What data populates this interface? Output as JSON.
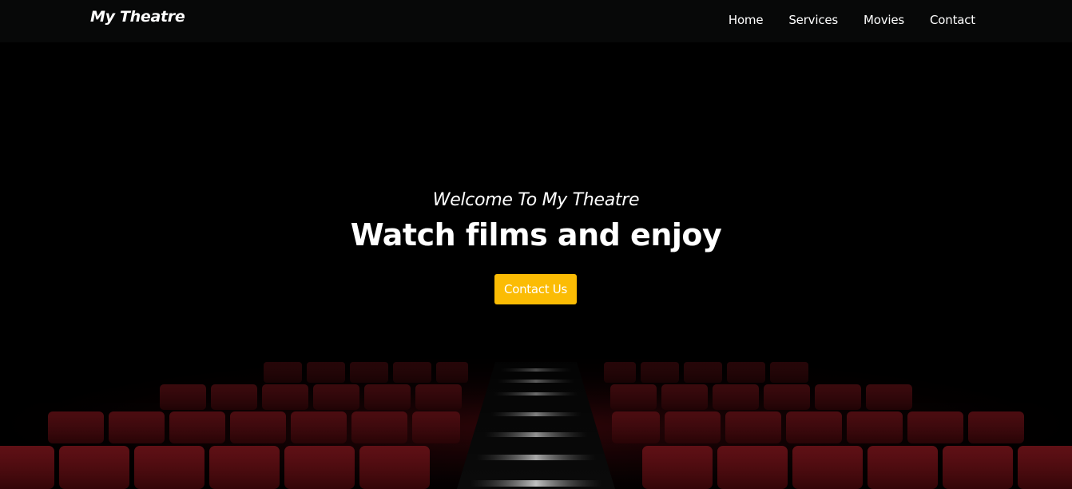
{
  "navbar": {
    "brand": "My Theatre",
    "links": [
      {
        "label": "Home"
      },
      {
        "label": "Services"
      },
      {
        "label": "Movies"
      },
      {
        "label": "Contact"
      }
    ]
  },
  "hero": {
    "welcome": "Welcome To My Theatre",
    "headline": "Watch films and enjoy",
    "cta_label": "Contact Us"
  },
  "colors": {
    "navbar_bg": "#070808",
    "page_bg": "#000000",
    "cta_bg": "#fbbc04",
    "seat_red": "#7a0f16",
    "text": "#ffffff"
  }
}
